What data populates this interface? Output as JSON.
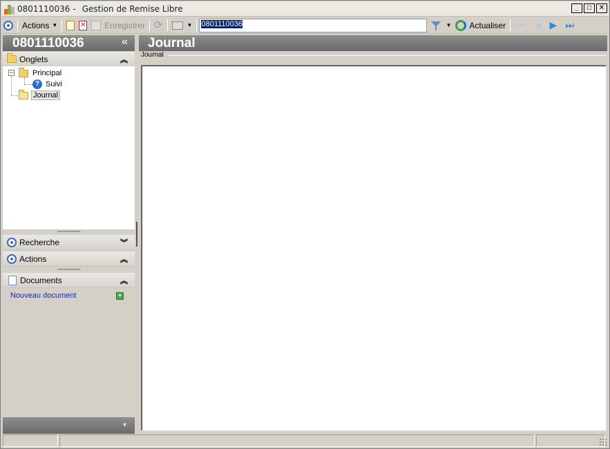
{
  "window": {
    "title_id": "0801110036",
    "title_sep": "-",
    "title_app": "Gestion de Remise Libre"
  },
  "toolbar": {
    "actions_label": "Actions",
    "save_label": "Enregistrer",
    "search_value": "0801110036",
    "refresh_label": "Actualiser"
  },
  "left": {
    "title": "0801110036",
    "collapse_glyph": "«",
    "tabs_header": "Onglets",
    "tree": {
      "root": "Principal",
      "child": "Suivi",
      "sibling": "Journal"
    },
    "search_header": "Recherche",
    "actions_header": "Actions",
    "documents_header": "Documents",
    "new_document": "Nouveau document"
  },
  "main": {
    "title": "Journal",
    "group_label": "Journal"
  },
  "colors": {
    "header_gray": "#7b7b7b",
    "link_blue": "#1a24c2",
    "selection": "#0a246a"
  }
}
